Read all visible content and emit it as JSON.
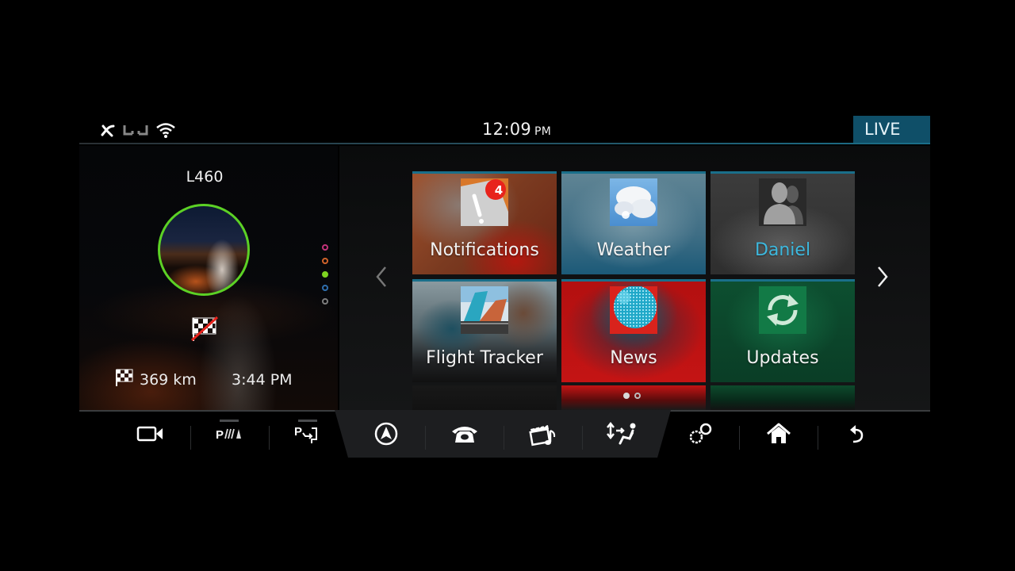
{
  "status_bar": {
    "icons": [
      "phone-off-icon",
      "seat-heat-icon",
      "wifi-icon"
    ],
    "time": "12:09",
    "ampm": "PM",
    "live_label": "LIVE"
  },
  "drive_panel": {
    "vehicle_name": "L460",
    "destination_status_icon": "no-destination-icon",
    "distance": "369 km",
    "eta": "3:44 PM",
    "profile_dots": [
      {
        "name": "profile-pink",
        "color": "#c2337a",
        "filled": false
      },
      {
        "name": "profile-orange",
        "color": "#d0632a",
        "filled": false
      },
      {
        "name": "profile-green",
        "color": "#7ed321",
        "filled": true
      },
      {
        "name": "profile-blue",
        "color": "#2f6fae",
        "filled": false
      },
      {
        "name": "profile-gray",
        "color": "#7c7c7c",
        "filled": false
      }
    ]
  },
  "home": {
    "tiles": [
      {
        "label": "Notifications",
        "icon": "notifications-icon",
        "badge": "4"
      },
      {
        "label": "Weather",
        "icon": "weather-icon"
      },
      {
        "label": "Daniel",
        "icon": "user-profile-icon"
      },
      {
        "label": "Flight Tracker",
        "icon": "flight-tracker-icon"
      },
      {
        "label": "News",
        "icon": "news-globe-icon"
      },
      {
        "label": "Updates",
        "icon": "updates-icon"
      }
    ],
    "page_indicator": {
      "current": 1,
      "total": 2
    },
    "colors": {
      "accent": "#1a6f8a",
      "daniel_label": "#3db8de"
    }
  },
  "toolbar": {
    "items": [
      "camera-icon",
      "park-assist-icon",
      "park-exit-icon",
      "navigation-icon",
      "phone-icon",
      "media-icon",
      "climate-icon",
      "apps-icon",
      "home-icon",
      "back-icon"
    ]
  }
}
